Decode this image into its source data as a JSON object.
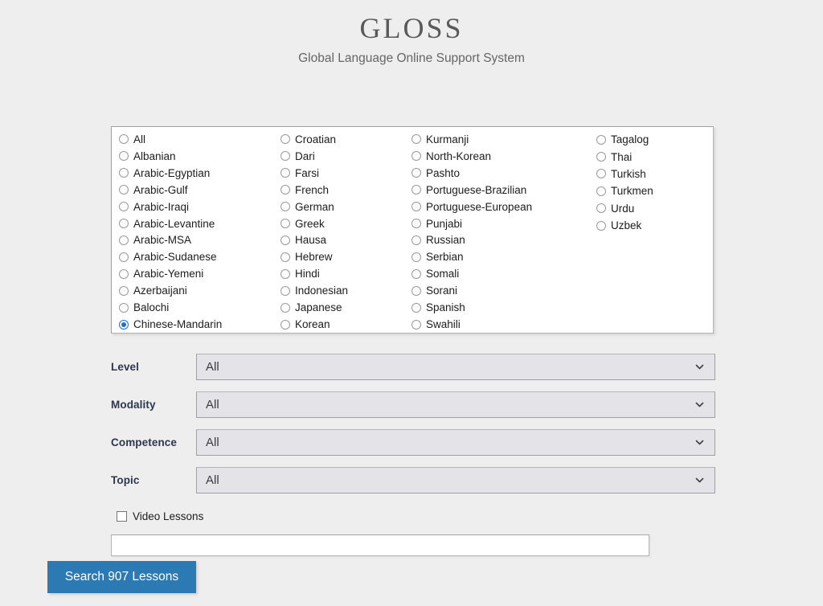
{
  "header": {
    "title": "GLOSS",
    "subtitle": "Global Language Online Support System"
  },
  "languages": {
    "selected": "Chinese-Mandarin",
    "columns": [
      [
        "All",
        "Albanian",
        "Arabic-Egyptian",
        "Arabic-Gulf",
        "Arabic-Iraqi",
        "Arabic-Levantine",
        "Arabic-MSA",
        "Arabic-Sudanese",
        "Arabic-Yemeni",
        "Azerbaijani",
        "Balochi",
        "Chinese-Mandarin"
      ],
      [
        "Croatian",
        "Dari",
        "Farsi",
        "French",
        "German",
        "Greek",
        "Hausa",
        "Hebrew",
        "Hindi",
        "Indonesian",
        "Japanese",
        "Korean"
      ],
      [
        "Kurmanji",
        "North-Korean",
        "Pashto",
        "Portuguese-Brazilian",
        "Portuguese-European",
        "Punjabi",
        "Russian",
        "Serbian",
        "Somali",
        "Sorani",
        "Spanish",
        "Swahili"
      ],
      [
        "Tagalog",
        "Thai",
        "Turkish",
        "Turkmen",
        "Urdu",
        "Uzbek"
      ]
    ]
  },
  "filters": {
    "level": {
      "label": "Level",
      "value": "All"
    },
    "modality": {
      "label": "Modality",
      "value": "All"
    },
    "competence": {
      "label": "Competence",
      "value": "All"
    },
    "topic": {
      "label": "Topic",
      "value": "All"
    }
  },
  "video_lessons": {
    "label": "Video Lessons",
    "checked": false
  },
  "keyword": {
    "value": "",
    "placeholder": ""
  },
  "search_button": {
    "label": "Search 907 Lessons",
    "lesson_count": 907
  },
  "colors": {
    "page_background": "#eeeeee",
    "accent_blue": "#2b7ab4",
    "radio_selected": "#1a6fd4",
    "label_text": "#2e3650",
    "title_text": "#5a5a5a"
  },
  "icons": {
    "chevron_down": "chevron-down-icon",
    "radio": "radio-button-icon",
    "checkbox": "checkbox-icon"
  }
}
